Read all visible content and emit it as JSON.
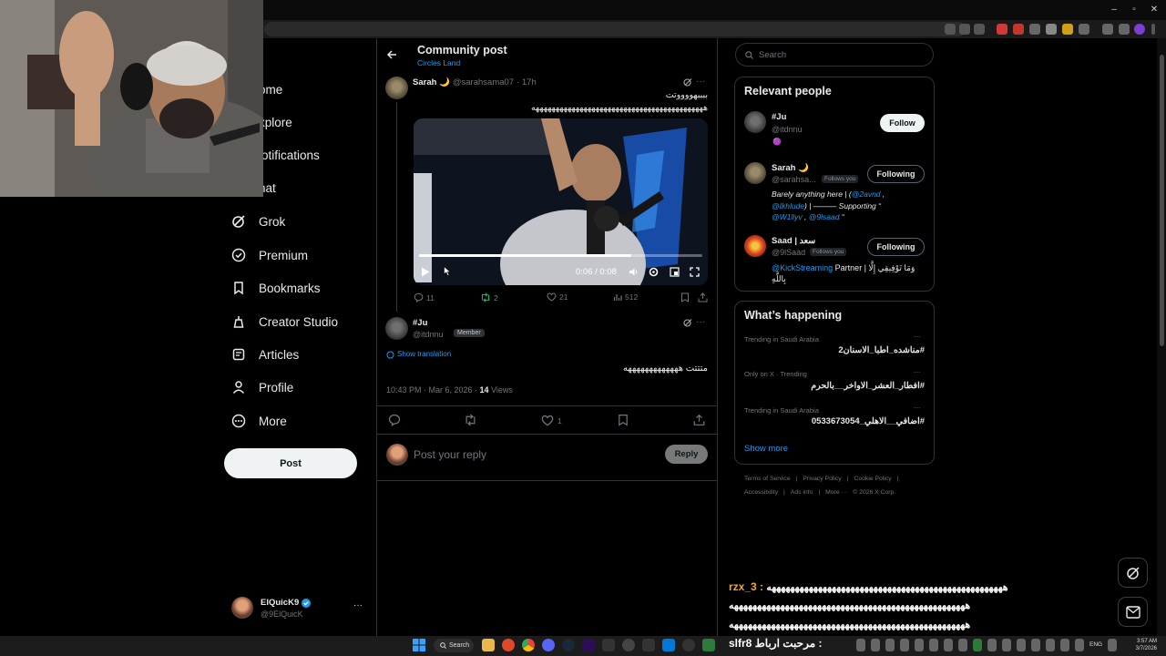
{
  "browser": {
    "window_controls": [
      "–",
      "▫",
      "✕"
    ]
  },
  "nav": {
    "items": [
      {
        "label": "Home",
        "visible": "ome",
        "icon": "home-icon"
      },
      {
        "label": "Explore",
        "visible": "xplore",
        "icon": "search-icon"
      },
      {
        "label": "Notifications",
        "visible": "lotifications",
        "icon": "bell-icon"
      },
      {
        "label": "Chat",
        "visible": "hat",
        "icon": "chat-icon"
      },
      {
        "label": "Grok",
        "visible": "Grok",
        "icon": "grok-icon"
      },
      {
        "label": "Premium",
        "visible": "Premium",
        "icon": "premium-icon"
      },
      {
        "label": "Bookmarks",
        "visible": "Bookmarks",
        "icon": "bookmark-icon"
      },
      {
        "label": "Creator Studio",
        "visible": "Creator Studio",
        "icon": "creator-studio-icon"
      },
      {
        "label": "Articles",
        "visible": "Articles",
        "icon": "articles-icon"
      },
      {
        "label": "Profile",
        "visible": "Profile",
        "icon": "profile-icon"
      },
      {
        "label": "More",
        "visible": "More",
        "icon": "more-icon"
      }
    ],
    "post_label": "Post",
    "account": {
      "name": "ElQuicK9",
      "handle": "@9ElQuicK",
      "menu": "···"
    }
  },
  "header": {
    "title": "Community post",
    "community": "Circles Land"
  },
  "post": {
    "author": "Sarah 🌙",
    "handle": "@sarahsama07",
    "time": "· 17h",
    "text_line1": "ببببهووووتت",
    "text_line2": "هههههههههههههههههههههههههههههههههههههههههههه",
    "video_time": "0:06 / 0:08",
    "video_progress": 0.75,
    "actions": {
      "replies": "11",
      "reposts": "2",
      "likes": "21",
      "views": "512"
    },
    "more": "···"
  },
  "reply": {
    "author": "#Ju",
    "handle": "@itdnnu",
    "badge": "Member",
    "show_translation": "Show translation",
    "text": "متتتت هههههههههههههه",
    "timestamp": "10:43 PM · Mar 6, 2026 · ",
    "views_count": "14",
    "views_label": " Views",
    "like_count": "1",
    "more": "···"
  },
  "composer": {
    "placeholder": "Post your reply",
    "reply_label": "Reply"
  },
  "search": {
    "placeholder": "Search"
  },
  "relevant_people": {
    "title": "Relevant people",
    "people": [
      {
        "name": "#Ju",
        "handle": "@itdnnu",
        "button": "Follow",
        "bio_emoji": "🟣"
      },
      {
        "name": "Sarah 🌙",
        "handle": "@sarahsa...",
        "follows_you": "Follows you",
        "button": "Following",
        "bio_1": "Barely anything here | (",
        "bio_1_link": "@2avnd",
        "bio_1_end": " ,",
        "bio_2_link": "@Ikhlude",
        "bio_2": ") | ——— Supporting “",
        "bio_3_link": "@W1llyv",
        "bio_3_sep": " , ",
        "bio_3_link2": "@9lsaad",
        "bio_3_end": " “"
      },
      {
        "name": "Saad | سعد",
        "handle": "@9lSaad",
        "follows_you": "Follows you",
        "button": "Following",
        "bio_link": "@KickStreaming",
        "bio_text": " Partner | وَمَا تَوْفِيقِي إِلَّا",
        "bio_line2": "بِاللَّهِ"
      }
    ]
  },
  "trending": {
    "title": "What’s happening",
    "items": [
      {
        "context": "Trending in Saudi Arabia",
        "topic": "#مناشده_اطبا_الاسنان2"
      },
      {
        "context": "Only on X · Trending",
        "topic": "#افطار_العشر_الاواخر__بالحرم"
      },
      {
        "context": "Trending in Saudi Arabia",
        "topic": "#اضافي__الاهلي_0533673054"
      }
    ],
    "show_more": "Show more",
    "more_dots": "···"
  },
  "footer": {
    "links": [
      "Terms of Service",
      "|",
      "Privacy Policy",
      "|",
      "Cookie Policy",
      "|"
    ],
    "links2": [
      "Accessibility",
      "|",
      "Ads info",
      "|",
      "More ···",
      "© 2026 X Corp."
    ]
  },
  "chat_overlay": {
    "user": "rzx_3 : ",
    "line1": "هههههههههههههههههههههههههههههههههههههههههههههههههههه",
    "line2": "هههههههههههههههههههههههههههههههههههههههههههههههههههه",
    "line3": "هههههههههههههههههههههههههههههههههههههههههههههههههههه"
  },
  "taskbar": {
    "search_label": "Search",
    "streamer_text": "slfr8 مرحبت ارباط :",
    "language": "ENG",
    "time": "3:57 AM",
    "date": "3/7/2026"
  },
  "colors": {
    "accent": "#1d9bf0",
    "background": "#000000",
    "border": "#2f3336",
    "muted": "#71767b",
    "repost_green": "#00ba7c"
  }
}
